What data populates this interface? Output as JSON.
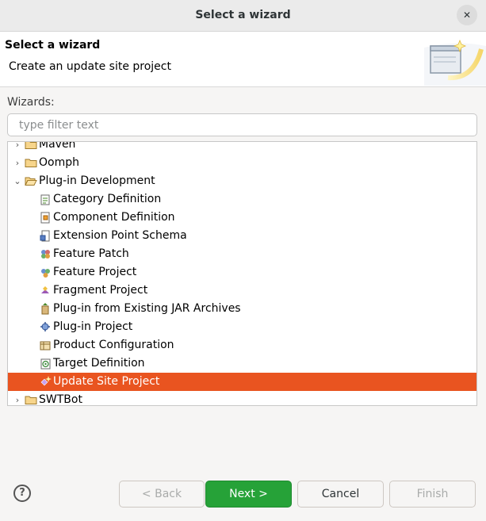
{
  "window": {
    "title": "Select a wizard"
  },
  "banner": {
    "title": "Select a wizard",
    "description": "Create an update site project"
  },
  "wizards": {
    "label": "Wizards:",
    "filter_placeholder": "type filter text",
    "tree": [
      {
        "label": "Maven",
        "type": "folder",
        "expanded": false
      },
      {
        "label": "Oomph",
        "type": "folder",
        "expanded": false
      },
      {
        "label": "Plug-in Development",
        "type": "folder",
        "expanded": true
      },
      {
        "label": "Category Definition",
        "icon": "category-definition-icon"
      },
      {
        "label": "Component Definition",
        "icon": "component-definition-icon"
      },
      {
        "label": "Extension Point Schema",
        "icon": "extension-point-schema-icon"
      },
      {
        "label": "Feature Patch",
        "icon": "feature-patch-icon"
      },
      {
        "label": "Feature Project",
        "icon": "feature-project-icon"
      },
      {
        "label": "Fragment Project",
        "icon": "fragment-project-icon"
      },
      {
        "label": "Plug-in from Existing JAR Archives",
        "icon": "plugin-from-jar-icon"
      },
      {
        "label": "Plug-in Project",
        "icon": "plugin-project-icon"
      },
      {
        "label": "Product Configuration",
        "icon": "product-configuration-icon"
      },
      {
        "label": "Target Definition",
        "icon": "target-definition-icon"
      },
      {
        "label": "Update Site Project",
        "icon": "update-site-project-icon",
        "selected": true
      },
      {
        "label": "SWTBot",
        "type": "folder",
        "expanded": false
      }
    ]
  },
  "buttons": {
    "back": "< Back",
    "next": "Next >",
    "cancel": "Cancel",
    "finish": "Finish",
    "help": "?"
  },
  "colors": {
    "selection": "#e95420",
    "primary_button": "#26a238"
  }
}
